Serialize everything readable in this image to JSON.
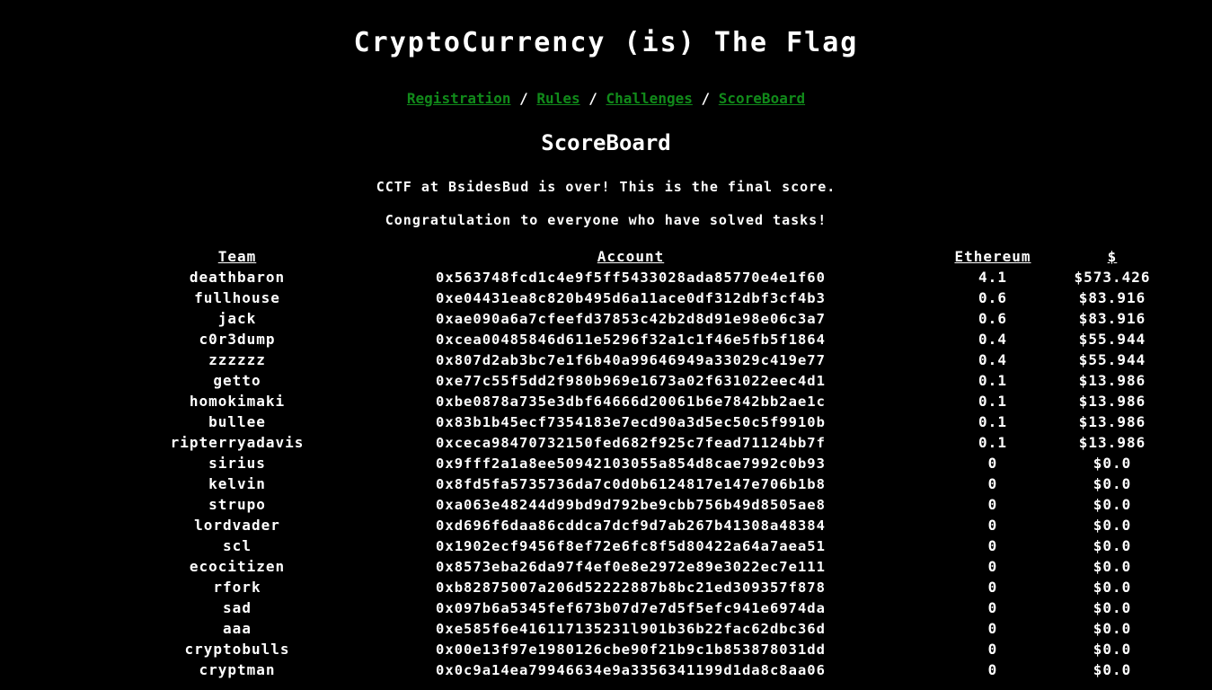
{
  "header": {
    "title": "CryptoCurrency (is) The Flag"
  },
  "nav": {
    "items": [
      {
        "label": "Registration"
      },
      {
        "label": "Rules"
      },
      {
        "label": "Challenges"
      },
      {
        "label": "ScoreBoard"
      }
    ],
    "separator": "/",
    "link_color": "#118a1a"
  },
  "page": {
    "subtitle": "ScoreBoard",
    "message1": "CCTF at BsidesBud is over! This is the final score.",
    "message2": "Congratulation to everyone who have solved tasks!"
  },
  "table": {
    "headers": {
      "team": "Team",
      "account": "Account",
      "ethereum": "Ethereum",
      "usd": "$"
    },
    "rows": [
      {
        "team": "deathbaron",
        "account": "0x563748fcd1c4e9f5ff5433028ada85770e4e1f60",
        "ethereum": "4.1",
        "usd": "$573.426"
      },
      {
        "team": "fullhouse",
        "account": "0xe04431ea8c820b495d6a11ace0df312dbf3cf4b3",
        "ethereum": "0.6",
        "usd": "$83.916"
      },
      {
        "team": "jack",
        "account": "0xae090a6a7cfeefd37853c42b2d8d91e98e06c3a7",
        "ethereum": "0.6",
        "usd": "$83.916"
      },
      {
        "team": "c0r3dump",
        "account": "0xcea00485846d611e5296f32a1c1f46e5fb5f1864",
        "ethereum": "0.4",
        "usd": "$55.944"
      },
      {
        "team": "zzzzzz",
        "account": "0x807d2ab3bc7e1f6b40a99646949a33029c419e77",
        "ethereum": "0.4",
        "usd": "$55.944"
      },
      {
        "team": "getto",
        "account": "0xe77c55f5dd2f980b969e1673a02f631022eec4d1",
        "ethereum": "0.1",
        "usd": "$13.986"
      },
      {
        "team": "homokimaki",
        "account": "0xbe0878a735e3dbf64666d20061b6e7842bb2ae1c",
        "ethereum": "0.1",
        "usd": "$13.986"
      },
      {
        "team": "bullee",
        "account": "0x83b1b45ecf7354183e7ecd90a3d5ec50c5f9910b",
        "ethereum": "0.1",
        "usd": "$13.986"
      },
      {
        "team": "ripterryadavis",
        "account": "0xceca98470732150fed682f925c7fead71124bb7f",
        "ethereum": "0.1",
        "usd": "$13.986"
      },
      {
        "team": "sirius",
        "account": "0x9fff2a1a8ee50942103055a854d8cae7992c0b93",
        "ethereum": "0",
        "usd": "$0.0"
      },
      {
        "team": "kelvin",
        "account": "0x8fd5fa5735736da7c0d0b6124817e147e706b1b8",
        "ethereum": "0",
        "usd": "$0.0"
      },
      {
        "team": "strupo",
        "account": "0xa063e48244d99bd9d792be9cbb756b49d8505ae8",
        "ethereum": "0",
        "usd": "$0.0"
      },
      {
        "team": "lordvader",
        "account": "0xd696f6daa86cddca7dcf9d7ab267b41308a48384",
        "ethereum": "0",
        "usd": "$0.0"
      },
      {
        "team": "scl",
        "account": "0x1902ecf9456f8ef72e6fc8f5d80422a64a7aea51",
        "ethereum": "0",
        "usd": "$0.0"
      },
      {
        "team": "ecocitizen",
        "account": "0x8573eba26da97f4ef0e8e2972e89e3022ec7e111",
        "ethereum": "0",
        "usd": "$0.0"
      },
      {
        "team": "rfork",
        "account": "0xb82875007a206d52222887b8bc21ed309357f878",
        "ethereum": "0",
        "usd": "$0.0"
      },
      {
        "team": "sad",
        "account": "0x097b6a5345fef673b07d7e7d5f5efc941e6974da",
        "ethereum": "0",
        "usd": "$0.0"
      },
      {
        "team": "aaa",
        "account": "0xe585f6e416117135231l901b36b22fac62dbc36d",
        "ethereum": "0",
        "usd": "$0.0"
      },
      {
        "team": "cryptobulls",
        "account": "0x00e13f97e1980126cbe90f21b9c1b853878031dd",
        "ethereum": "0",
        "usd": "$0.0"
      },
      {
        "team": "cryptman",
        "account": "0x0c9a14ea79946634e9a3356341199d1da8c8aa06",
        "ethereum": "0",
        "usd": "$0.0"
      }
    ]
  }
}
